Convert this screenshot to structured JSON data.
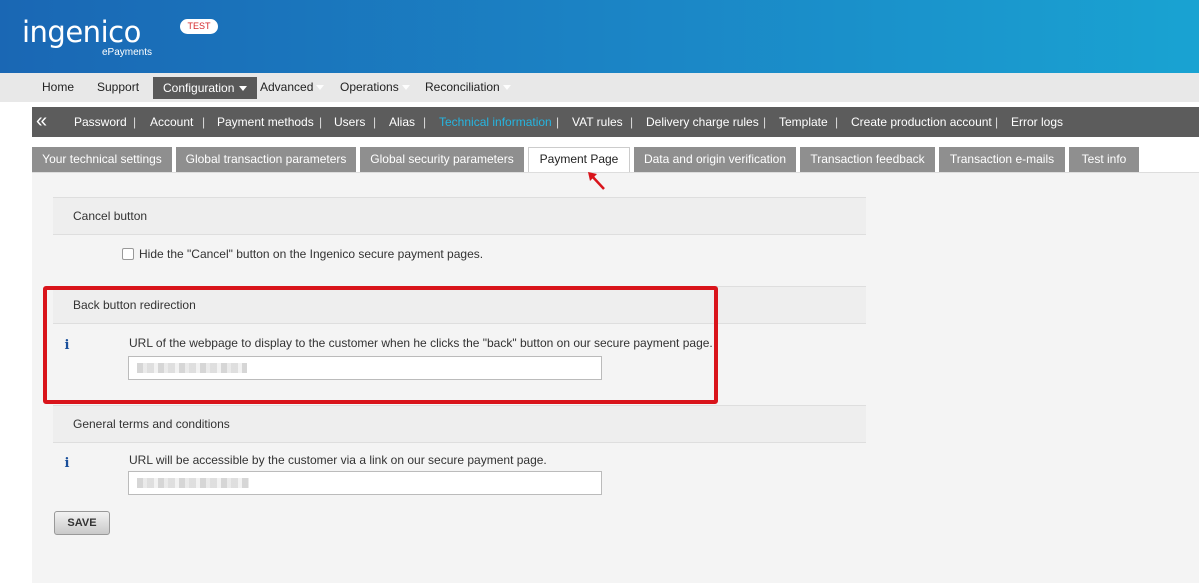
{
  "brand": {
    "name": "ingenico",
    "sub": "ePayments",
    "env_badge": "TEST"
  },
  "main_nav": [
    {
      "label": "Home"
    },
    {
      "label": "Support"
    },
    {
      "label": "Configuration"
    },
    {
      "label": "Advanced"
    },
    {
      "label": "Operations"
    },
    {
      "label": "Reconciliation"
    }
  ],
  "sub_nav": {
    "collapse_glyph": "«",
    "items": [
      {
        "label": "Password"
      },
      {
        "label": "Account"
      },
      {
        "label": "Payment methods"
      },
      {
        "label": "Users"
      },
      {
        "label": "Alias"
      },
      {
        "label": "Technical information"
      },
      {
        "label": "VAT rules"
      },
      {
        "label": "Delivery charge rules"
      },
      {
        "label": "Template"
      },
      {
        "label": "Create production account"
      },
      {
        "label": "Error logs"
      }
    ],
    "separator": "|"
  },
  "tabs": [
    {
      "label": "Your technical settings"
    },
    {
      "label": "Global transaction parameters"
    },
    {
      "label": "Global security parameters"
    },
    {
      "label": "Payment Page"
    },
    {
      "label": "Data and origin verification"
    },
    {
      "label": "Transaction feedback"
    },
    {
      "label": "Transaction e-mails"
    },
    {
      "label": "Test info"
    }
  ],
  "sections": {
    "cancel": {
      "title": "Cancel button",
      "checkbox_label": "Hide the \"Cancel\" button on the Ingenico secure payment pages.",
      "checked": false
    },
    "back": {
      "title": "Back button redirection",
      "info_glyph": "i",
      "description": "URL of the webpage to display to the customer when he clicks the \"back\" button on our secure payment page."
    },
    "terms": {
      "title": "General terms and conditions",
      "info_glyph": "i",
      "description": "URL will be accessible by the customer via a link on our secure payment page."
    }
  },
  "save_label": "SAVE",
  "colors": {
    "header_start": "#1a67b4",
    "header_end": "#19a3d2",
    "highlight_box": "#d9141b",
    "active_subnav": "#26b5e0"
  }
}
